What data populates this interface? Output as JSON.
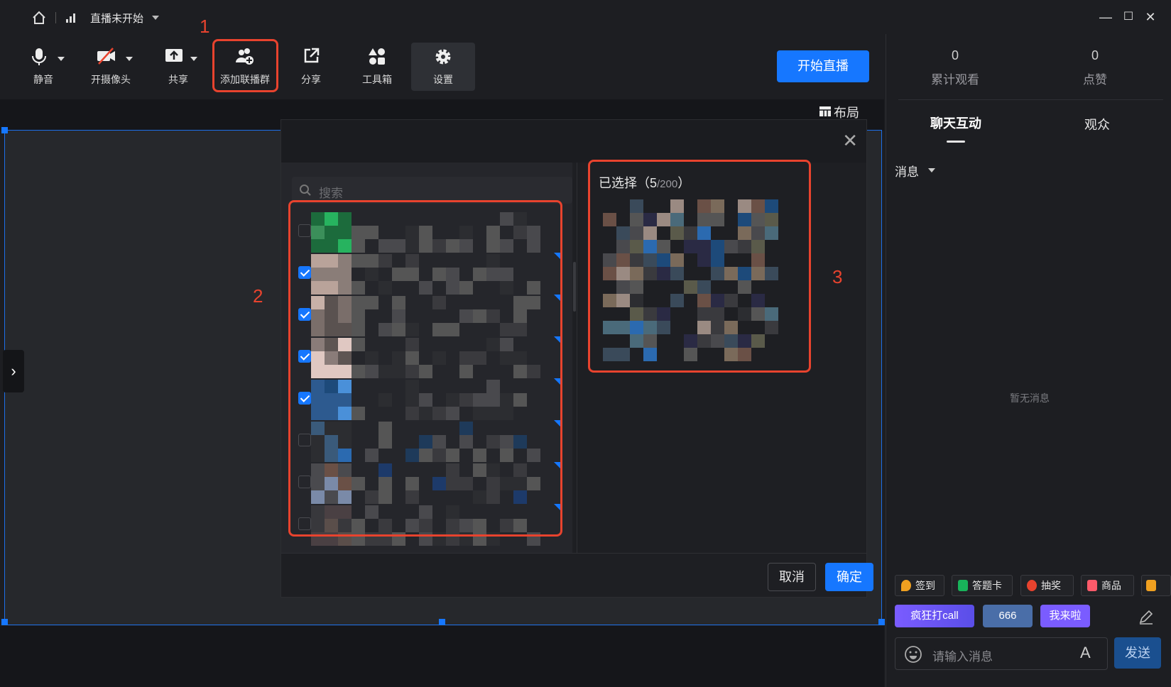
{
  "titlebar": {
    "status": "直播未开始",
    "icons": [
      "home-icon",
      "signal-icon",
      "chevron-down-icon",
      "minimize-icon",
      "maximize-icon",
      "close-icon"
    ]
  },
  "toolbar": {
    "mute": "静音",
    "camera": "开摄像头",
    "share_screen": "共享",
    "add_co_host": "添加联播群",
    "share": "分享",
    "toolbox": "工具箱",
    "settings": "设置",
    "start_live": "开始直播"
  },
  "annotations": {
    "n1": "1",
    "n2": "2",
    "n3": "3"
  },
  "stage": {
    "layout": "布局"
  },
  "dialog": {
    "search_placeholder": "搜索",
    "selected_label": "已选择（",
    "selected_count": "5",
    "selected_total": "/200",
    "selected_close": "）",
    "rows": [
      {
        "checked": false
      },
      {
        "checked": true
      },
      {
        "checked": true
      },
      {
        "checked": true
      },
      {
        "checked": true
      },
      {
        "checked": false
      },
      {
        "checked": false
      },
      {
        "checked": false
      }
    ],
    "cancel": "取消",
    "confirm": "确定"
  },
  "right_panel": {
    "total_views_value": "0",
    "total_views_label": "累计观看",
    "likes_value": "0",
    "likes_label": "点赞",
    "tab_chat": "聊天互动",
    "tab_audience": "观众",
    "message_filter": "消息",
    "empty": "暂无消息",
    "tools": [
      "签到",
      "答题卡",
      "抽奖",
      "商品"
    ],
    "reactions": [
      "疯狂打call",
      "666",
      "我来啦"
    ],
    "input_placeholder": "请输入消息",
    "send": "发送"
  },
  "colors": {
    "accent": "#1677ff",
    "highlight": "#e8432e",
    "background": "#1d1e22"
  }
}
